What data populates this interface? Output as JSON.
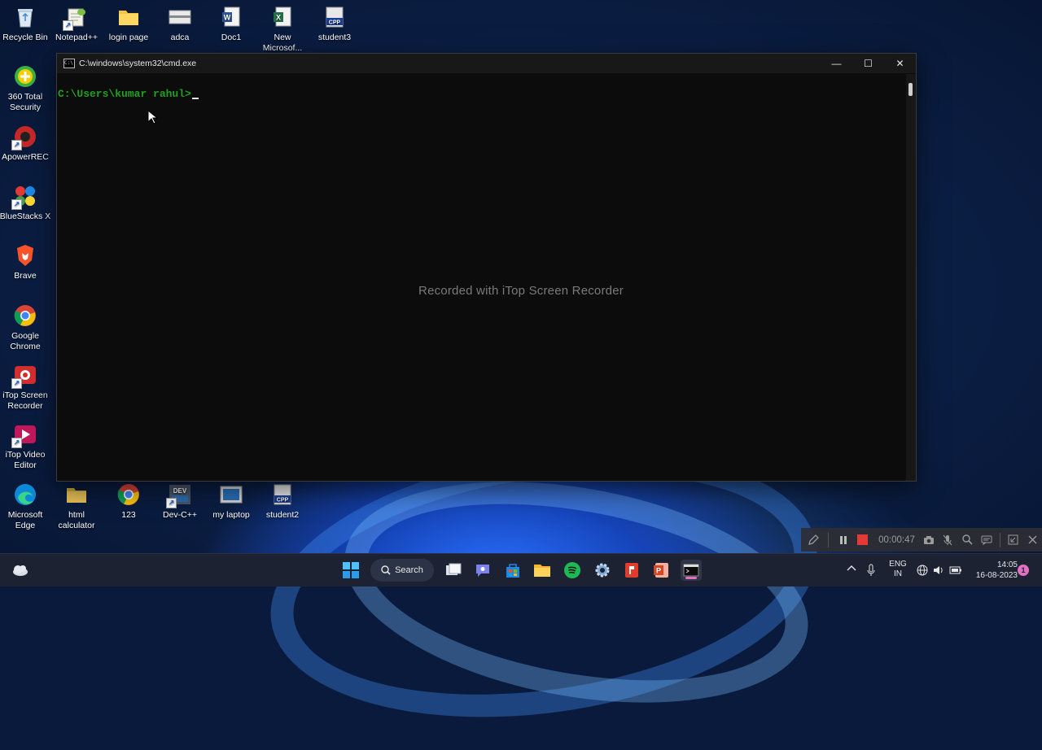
{
  "desktop": {
    "top_row": [
      {
        "label": "Recycle Bin",
        "icon": "recycle-bin-icon"
      },
      {
        "label": "Notepad++",
        "icon": "notepad-plus-icon"
      },
      {
        "label": "login page",
        "icon": "folder-icon"
      },
      {
        "label": "adca",
        "icon": "document-icon"
      },
      {
        "label": "Doc1",
        "icon": "word-icon"
      },
      {
        "label": "New Microsof...",
        "icon": "excel-icon"
      },
      {
        "label": "student3",
        "icon": "cpp-file-icon"
      }
    ],
    "left_column": [
      {
        "label": "360 Total Security",
        "icon": "security-icon"
      },
      {
        "label": "ApowerREC",
        "icon": "apowerrec-icon"
      },
      {
        "label": "BlueStacks X",
        "icon": "bluestacks-icon"
      },
      {
        "label": "Brave",
        "icon": "brave-icon"
      },
      {
        "label": "Google Chrome",
        "icon": "chrome-icon"
      },
      {
        "label": "iTop Screen Recorder",
        "icon": "itop-recorder-icon"
      },
      {
        "label": "iTop Video Editor",
        "icon": "itop-video-icon"
      },
      {
        "label": "Microsoft Edge",
        "icon": "edge-icon"
      }
    ],
    "bottom_row": [
      {
        "label": "html calculator",
        "icon": "folder-icon"
      },
      {
        "label": "123",
        "icon": "chrome-icon"
      },
      {
        "label": "Dev-C++",
        "icon": "devcpp-icon"
      },
      {
        "label": "my laptop",
        "icon": "image-icon"
      },
      {
        "label": "student2",
        "icon": "cpp-file-icon"
      }
    ]
  },
  "cmd": {
    "title": "C:\\windows\\system32\\cmd.exe",
    "prompt": "C:\\Users\\kumar rahul>",
    "minimize": "—",
    "maximize": "☐",
    "close": "✕"
  },
  "watermark": "Recorded with iTop Screen Recorder",
  "recorder": {
    "timer": "00:00:47"
  },
  "taskbar": {
    "search_label": "Search",
    "language_line1": "ENG",
    "language_line2": "IN",
    "time": "14:05",
    "date": "16-08-2023",
    "notification_count": "1"
  },
  "colors": {
    "console_text": "#20a020",
    "console_bg": "#0c0c0c",
    "taskbar_bg": "#1c2232",
    "record_red": "#e53935"
  }
}
